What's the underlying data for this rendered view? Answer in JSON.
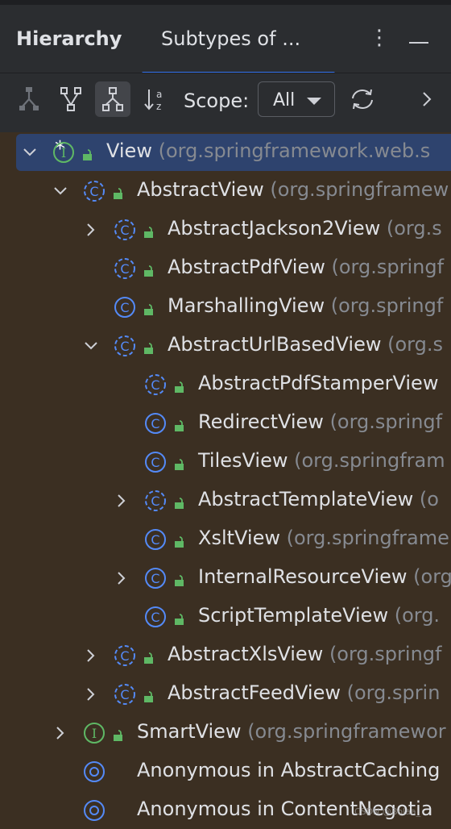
{
  "header": {
    "tab_hierarchy": "Hierarchy",
    "tab_subtypes": "Subtypes of ...",
    "kebab": "⋮"
  },
  "toolbar": {
    "scope_label": "Scope:",
    "scope_value": "All"
  },
  "tree": {
    "rows": [
      {
        "name": "View",
        "pkg": " (org.springframework.web.s",
        "star": "*",
        "kind": "interface",
        "expanded": true,
        "selected": true
      },
      {
        "name": "AbstractView",
        "pkg": " (org.springframew",
        "kind": "abstract-class",
        "expanded": true
      },
      {
        "name": "AbstractJackson2View",
        "pkg": " (org.s",
        "kind": "abstract-class",
        "expandable": true
      },
      {
        "name": "AbstractPdfView",
        "pkg": " (org.springf",
        "kind": "abstract-class"
      },
      {
        "name": "MarshallingView",
        "pkg": " (org.springf",
        "kind": "class"
      },
      {
        "name": "AbstractUrlBasedView",
        "pkg": " (org.s",
        "kind": "abstract-class",
        "expanded": true
      },
      {
        "name": "AbstractPdfStamperView",
        "pkg": "",
        "kind": "abstract-class"
      },
      {
        "name": "RedirectView",
        "pkg": " (org.springf",
        "kind": "class"
      },
      {
        "name": "TilesView",
        "pkg": " (org.springfram",
        "kind": "class"
      },
      {
        "name": "AbstractTemplateView",
        "pkg": " (o",
        "kind": "abstract-class",
        "expandable": true
      },
      {
        "name": "XsltView",
        "pkg": " (org.springframe",
        "kind": "class"
      },
      {
        "name": "InternalResourceView",
        "pkg": " (org",
        "kind": "class",
        "expandable": true
      },
      {
        "name": "ScriptTemplateView",
        "pkg": " (org.",
        "kind": "class"
      },
      {
        "name": "AbstractXlsView",
        "pkg": " (org.springf",
        "kind": "abstract-class",
        "expandable": true
      },
      {
        "name": "AbstractFeedView",
        "pkg": " (org.sprin",
        "kind": "abstract-class",
        "expandable": true
      },
      {
        "name": "SmartView",
        "pkg": " (org.springframewor",
        "kind": "interface",
        "expandable": true
      },
      {
        "name": "Anonymous in AbstractCaching",
        "pkg": "",
        "kind": "anonymous"
      },
      {
        "name": "Anonymous in ContentNegotia",
        "pkg": "",
        "kind": "anonymous"
      }
    ]
  },
  "watermark": "CSDN @Bolaa_",
  "colors": {
    "accent": "#3574f0",
    "class_icon": "#548af7",
    "interface_icon": "#5fb865",
    "lock": "#5fb865",
    "package_text": "#868a91",
    "selection": "#2e436e"
  }
}
